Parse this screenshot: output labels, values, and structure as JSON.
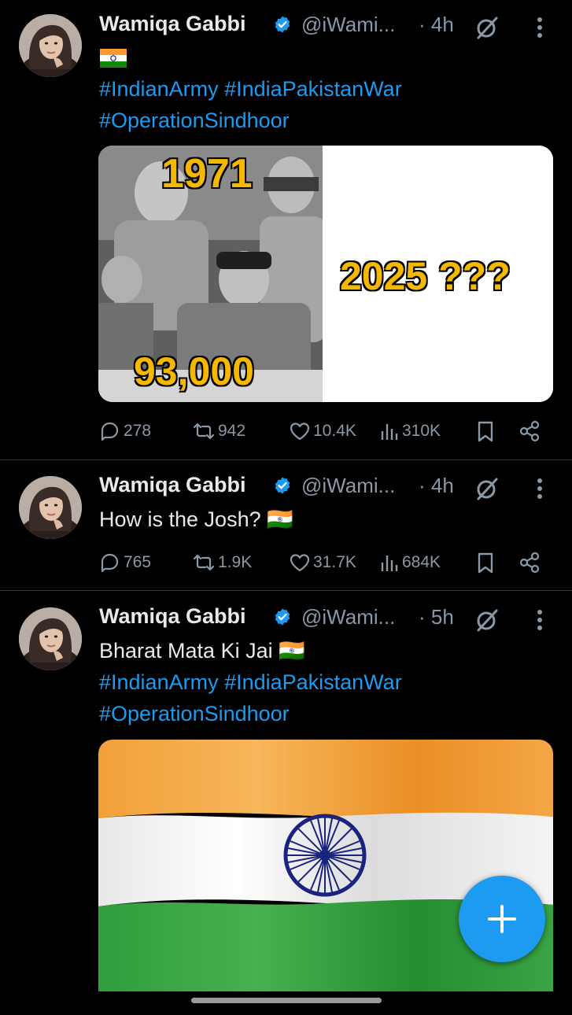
{
  "tweets": [
    {
      "name": "Wamiqa Gabbi",
      "handle": "@iWami...",
      "time": "· 4h",
      "line1": "🇮🇳",
      "hashtags_line1": "#IndianArmy #IndiaPakistanWar",
      "hashtags_line2": "#OperationSindhoor",
      "media_left_year": "1971",
      "media_left_count": "93,000",
      "media_right_text": "2025 ???",
      "replies": "278",
      "retweets": "942",
      "likes": "10.4K",
      "views": "310K"
    },
    {
      "name": "Wamiqa Gabbi",
      "handle": "@iWami...",
      "time": "· 4h",
      "text": "How is the Josh? 🇮🇳",
      "replies": "765",
      "retweets": "1.9K",
      "likes": "31.7K",
      "views": "684K"
    },
    {
      "name": "Wamiqa Gabbi",
      "handle": "@iWami...",
      "time": "· 5h",
      "text": "Bharat Mata Ki Jai 🇮🇳",
      "hashtags_line1": "#IndianArmy #IndiaPakistanWar",
      "hashtags_line2": "#OperationSindhoor"
    }
  ],
  "colors": {
    "background": "#000000",
    "link": "#1d9bf0",
    "secondary_text": "#8b98a5",
    "fab": "#1d9bf0"
  }
}
